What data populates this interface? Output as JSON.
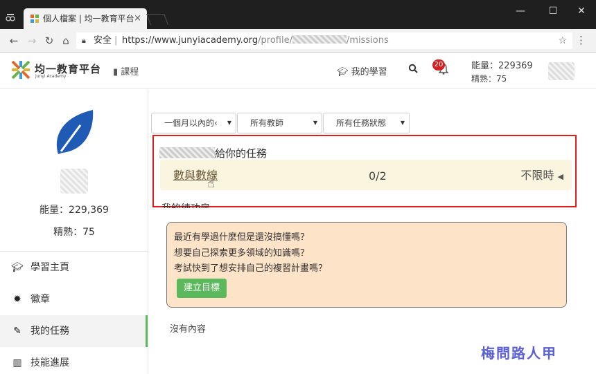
{
  "browser": {
    "tab_title": "個人檔案 | 均一教育平台",
    "tab_close": "×",
    "secure_label": "安全",
    "url_prefix": "https://www.junyiacademy.org",
    "url_path": "/profile/",
    "url_suffix": "/missions",
    "icons": [
      "back-icon",
      "forward-icon",
      "reload-icon",
      "home-icon",
      "lock-icon",
      "star-icon",
      "kebab-icon",
      "minimize-icon",
      "maximize-icon",
      "close-icon"
    ]
  },
  "header": {
    "logo_text": "均一教育平台",
    "logo_sub": "Junyi Academy",
    "courses": "課程",
    "my_learning": "我的學習",
    "notification_count": "20",
    "energy": "能量：229369",
    "mastery": "精熟：75"
  },
  "sidebar": {
    "energy": "能量：229,369",
    "mastery": "精熟：75",
    "items": [
      {
        "label": "學習主頁",
        "icon": "graduation-cap-icon"
      },
      {
        "label": "徽章",
        "icon": "badge-icon"
      },
      {
        "label": "我的任務",
        "icon": "pencil-icon",
        "active": true
      },
      {
        "label": "技能進展",
        "icon": "bar-chart-icon"
      }
    ],
    "accent": "#5cb85c"
  },
  "filters": {
    "time": "一個月以內的‹",
    "teacher": "所有教師",
    "status": "所有任務狀態"
  },
  "assigned": {
    "title_suffix": "給你的任務",
    "mission_name": "數與數線",
    "progress": "0/2",
    "time_limit": "不限時"
  },
  "practice": {
    "heading": "我的練功房",
    "lines": [
      "最近有學過什麼但是還沒搞懂嗎？",
      "想要自己探索更多領域的知識嗎？",
      "考試快到了想安排自己的複習計畫嗎？"
    ],
    "button": "建立目標",
    "empty": "沒有內容"
  },
  "watermark": "梅問路人甲",
  "colors": {
    "highlight_border": "#e01b1b",
    "mission_bg": "#fbf4de",
    "goal_bg": "#fde3c7",
    "badge": "#d32020"
  }
}
